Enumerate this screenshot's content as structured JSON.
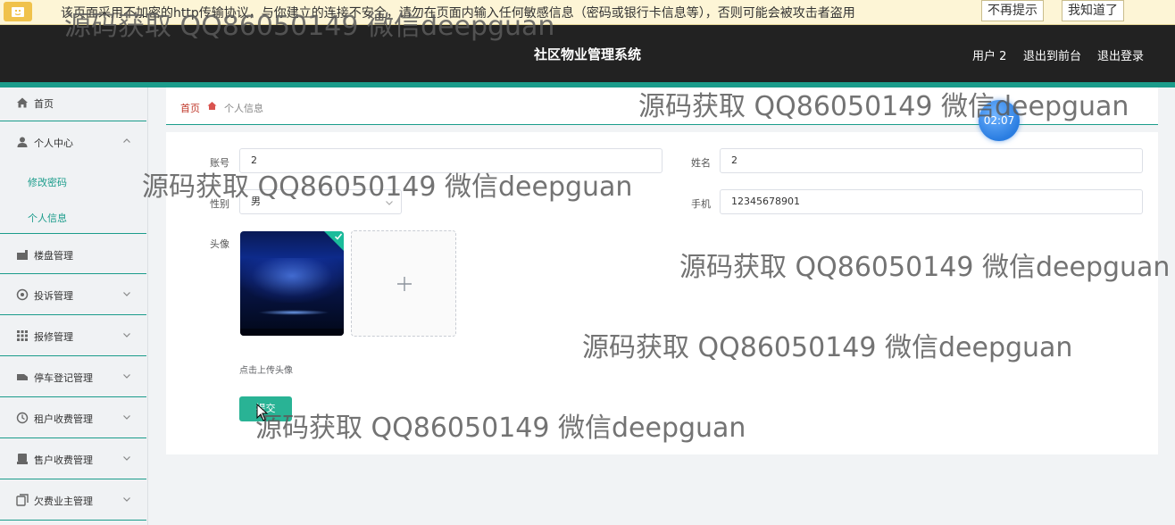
{
  "warning_bar": {
    "text": "该页面采用不加密的http传输协议，与你建立的连接不安全，请勿在页面内输入任何敏感信息（密码或银行卡信息等），否则可能会被攻击者盗用",
    "btn_dismiss": "不再提示",
    "btn_ok": "我知道了"
  },
  "header": {
    "title": "社区物业管理系统",
    "user": "用户 2",
    "to_front": "退出到前台",
    "logout": "退出登录"
  },
  "sidebar": {
    "home": "首页",
    "personal_center": "个人中心",
    "change_password": "修改密码",
    "personal_info": "个人信息",
    "items": [
      {
        "label": "楼盘管理",
        "icon": "building-icon"
      },
      {
        "label": "投诉管理",
        "icon": "complaint-icon"
      },
      {
        "label": "报修管理",
        "icon": "grid-icon"
      },
      {
        "label": "停车登记管理",
        "icon": "car-icon"
      },
      {
        "label": "租户收费管理",
        "icon": "clock-icon"
      },
      {
        "label": "售户收费管理",
        "icon": "bill-icon"
      },
      {
        "label": "欠费业主管理",
        "icon": "copy-icon"
      }
    ]
  },
  "breadcrumb": {
    "home": "首页",
    "current": "个人信息"
  },
  "form": {
    "account_label": "账号",
    "account_value": "2",
    "name_label": "姓名",
    "name_value": "2",
    "gender_label": "性别",
    "gender_value": "男",
    "phone_label": "手机",
    "phone_value": "12345678901",
    "avatar_label": "头像",
    "upload_hint": "点击上传头像",
    "submit_label": "提交"
  },
  "timer": "02:07",
  "watermark": "源码获取 QQ86050149 微信deepguan",
  "colors": {
    "accent": "#1b9c8b",
    "header_bg": "#222222",
    "warning_bg": "#fdf5d6",
    "submit_bg": "#29b395"
  }
}
